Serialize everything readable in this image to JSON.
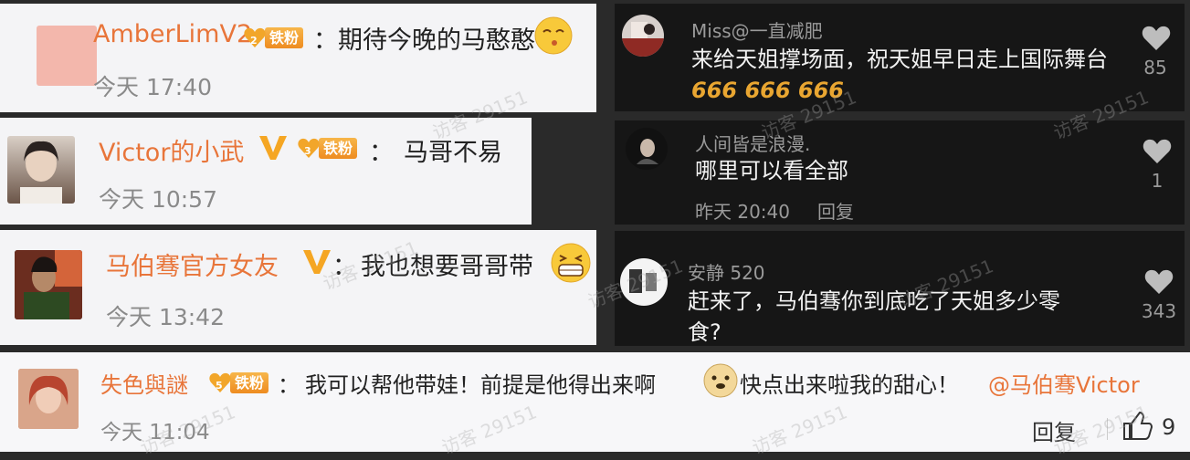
{
  "left_comments": [
    {
      "user": "AmberLimV2",
      "badge_level": "2",
      "badge_label": "铁粉",
      "text": "期待今晚的马憨憨",
      "time": "今天 17:40",
      "emoji": "kiss-emoji"
    },
    {
      "user": "Victor的小武",
      "badge_level": "3",
      "badge_label": "铁粉",
      "text": "马哥不易",
      "time": "今天 10:57"
    },
    {
      "user": "马伯骞官方女友",
      "text": "我也想要哥哥带",
      "time": "今天 13:42",
      "emoji": "grin-emoji"
    }
  ],
  "right_comments": [
    {
      "user": "Miss@一直减肥",
      "text": "来给天姐撑场面，祝天姐早日走上国际舞台",
      "suffix": "666 666 666",
      "likes": "85"
    },
    {
      "user": "人间皆是浪漫.",
      "text": "哪里可以看全部",
      "time": "昨天 20:40",
      "reply": "回复",
      "likes": "1"
    },
    {
      "user": "安静 520",
      "text": "赶来了，马伯骞你到底吃了天姐多少零食?",
      "likes": "343"
    }
  ],
  "bottom_comment": {
    "user": "失色與謎",
    "badge_level": "5",
    "badge_label": "铁粉",
    "text_part1": "我可以帮他带娃！前提是他得出来啊",
    "text_part2": "快点出来啦我的甜心！",
    "mention": "@马伯骞Victor",
    "time": "今天 11:04",
    "reply": "回复",
    "likes": "9"
  },
  "watermark": "访客 29151",
  "colon": "："
}
